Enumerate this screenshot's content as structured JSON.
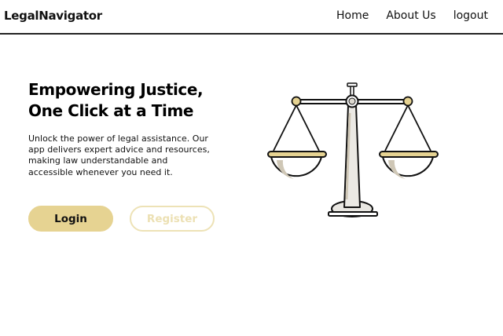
{
  "brand": "LegalNavigator",
  "nav": {
    "home": "Home",
    "about": "About Us",
    "logout": "logout"
  },
  "hero": {
    "title_line1": "Empowering Justice,",
    "title_line2": "One Click at a Time",
    "description": "Unlock the power of legal assistance. Our app delivers expert advice and resources, making law understandable and accessible whenever you need it."
  },
  "buttons": {
    "login": "Login",
    "register": "Register"
  },
  "illustration": {
    "icon": "scales-of-justice-icon"
  },
  "colors": {
    "accent": "#e6d392",
    "accent_light": "#ede2b6",
    "outline": "#111111",
    "shadow": "#cfc7b6"
  }
}
